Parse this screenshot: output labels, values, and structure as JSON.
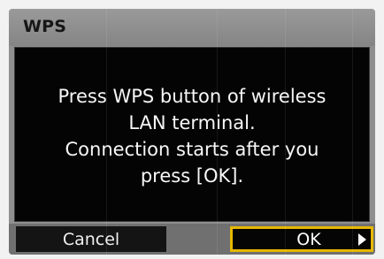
{
  "dialog": {
    "title": "WPS",
    "message_line1": "Press WPS button of wireless",
    "message_line2": "LAN terminal.",
    "message_line3": "Connection starts after you",
    "message_line4": "press [OK]."
  },
  "buttons": {
    "cancel_label": "Cancel",
    "ok_label": "OK"
  },
  "icons": {
    "ok_arrow": "arrow-right-icon"
  },
  "colors": {
    "selection_border": "#e6b800",
    "panel_background": "#040404",
    "title_bar": "#8f8f8f"
  }
}
